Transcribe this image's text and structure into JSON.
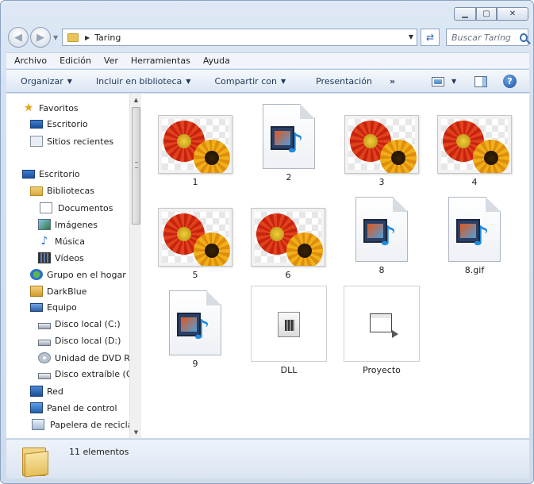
{
  "window": {
    "caption_buttons": [
      "minimize",
      "maximize",
      "close"
    ]
  },
  "address": {
    "path": "Taring"
  },
  "search": {
    "placeholder": "Buscar Taring"
  },
  "menu": [
    "Archivo",
    "Edición",
    "Ver",
    "Herramientas",
    "Ayuda"
  ],
  "toolbar": {
    "organize": "Organizar",
    "include": "Incluir en biblioteca",
    "share": "Compartir con",
    "slideshow": "Presentación",
    "more": "»"
  },
  "nav": {
    "items": [
      {
        "label": "Favoritos",
        "icon": "star-icon"
      },
      {
        "label": "Escritorio",
        "icon": "desktop-icon"
      },
      {
        "label": "Sitios recientes",
        "icon": "recent-places-icon"
      },
      {
        "label": "Escritorio",
        "icon": "desktop-icon"
      },
      {
        "label": "Bibliotecas",
        "icon": "libraries-icon"
      },
      {
        "label": "Documentos",
        "icon": "documents-icon"
      },
      {
        "label": "Imágenes",
        "icon": "pictures-icon"
      },
      {
        "label": "Música",
        "icon": "music-icon"
      },
      {
        "label": "Vídeos",
        "icon": "videos-icon"
      },
      {
        "label": "Grupo en el hogar",
        "icon": "homegroup-icon"
      },
      {
        "label": "DarkBlue",
        "icon": "user-folder-icon"
      },
      {
        "label": "Equipo",
        "icon": "computer-icon"
      },
      {
        "label": "Disco local (C:)",
        "icon": "local-disk-icon"
      },
      {
        "label": "Disco local (D:)",
        "icon": "local-disk-icon"
      },
      {
        "label": "Unidad de DVD RW",
        "icon": "dvd-drive-icon"
      },
      {
        "label": "Disco extraíble (G",
        "icon": "removable-disk-icon"
      },
      {
        "label": "Red",
        "icon": "network-icon"
      },
      {
        "label": "Panel de control",
        "icon": "control-panel-icon"
      },
      {
        "label": "Papelera de reciclaj",
        "icon": "recycle-bin-icon"
      }
    ]
  },
  "files": [
    {
      "name": "1",
      "type": "image"
    },
    {
      "name": "2",
      "type": "media"
    },
    {
      "name": "3",
      "type": "image"
    },
    {
      "name": "4",
      "type": "image"
    },
    {
      "name": "5",
      "type": "image"
    },
    {
      "name": "6",
      "type": "image"
    },
    {
      "name": "8",
      "type": "media"
    },
    {
      "name": "8.gif",
      "type": "media"
    },
    {
      "name": "9",
      "type": "media"
    },
    {
      "name": "DLL",
      "type": "dll-folder"
    },
    {
      "name": "Proyecto",
      "type": "project-folder"
    }
  ],
  "status": {
    "count": "11 elementos"
  },
  "colors": {
    "frame": "#d4e1f1",
    "accent": "#2b62b7"
  }
}
